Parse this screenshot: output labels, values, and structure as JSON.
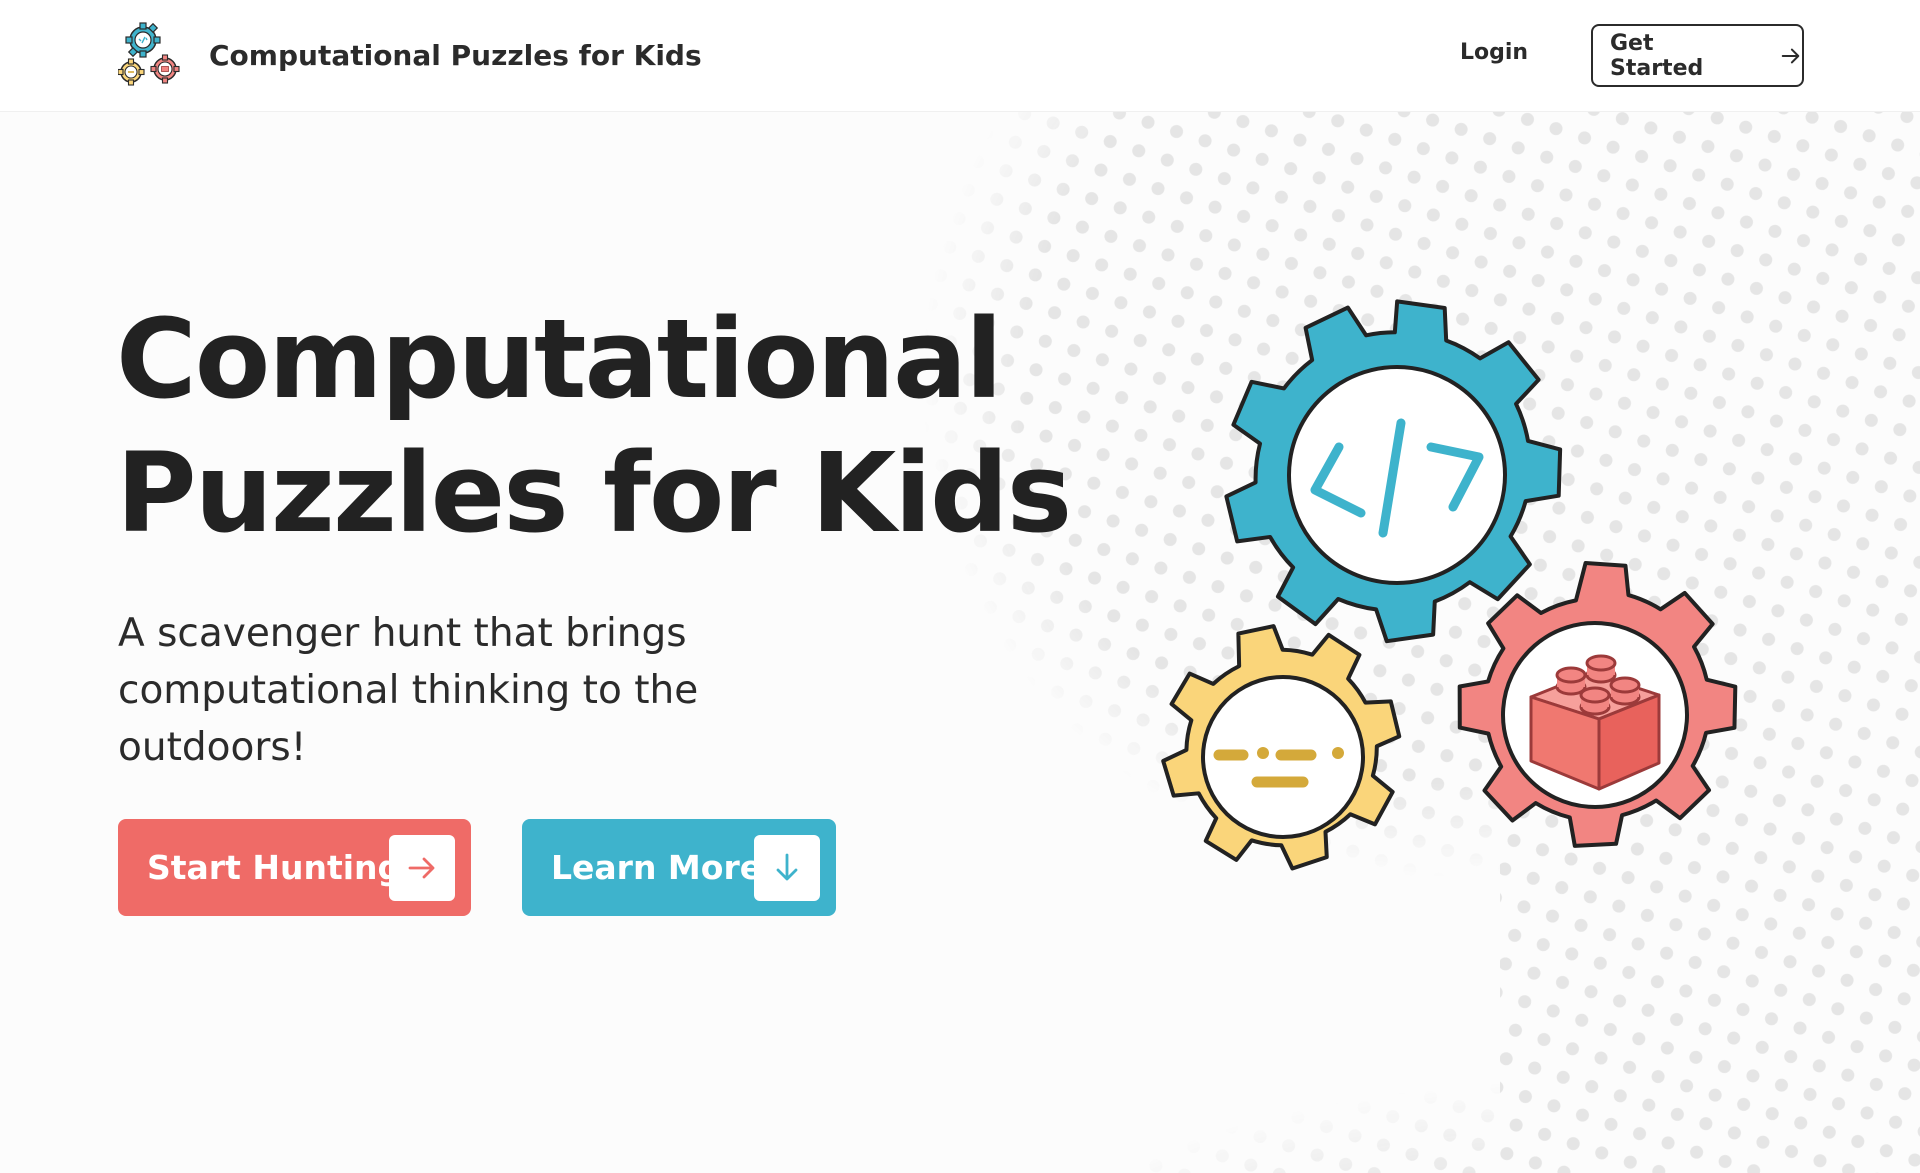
{
  "header": {
    "brand_name": "Computational Puzzles for Kids",
    "login_label": "Login",
    "cta_label": "Get Started",
    "logo_icon": "gears-logo-icon",
    "cta_icon": "arrow-right-icon"
  },
  "hero": {
    "title_line1": "Computational",
    "title_line2": "Puzzles for Kids",
    "subtitle_line1": "A scavenger hunt that brings",
    "subtitle_line2": "computational thinking to the",
    "subtitle_line3": "outdoors!",
    "primary_button": {
      "label": "Start Hunting",
      "icon": "arrow-right-icon",
      "color": "#ef6b67"
    },
    "secondary_button": {
      "label": "Learn More",
      "icon": "arrow-down-icon",
      "color": "#3eb3cc"
    }
  },
  "illustration": {
    "gears": [
      {
        "name": "code-gear",
        "icon": "code-brackets-icon",
        "color": "#3eb3cc"
      },
      {
        "name": "pattern-gear",
        "icon": "dash-pattern-icon",
        "color": "#fad57a"
      },
      {
        "name": "brick-gear",
        "icon": "toy-brick-icon",
        "color": "#f28582"
      }
    ]
  },
  "colors": {
    "text_primary": "#222222",
    "accent_red": "#ef6b67",
    "accent_blue": "#3eb3cc",
    "accent_yellow": "#fad57a",
    "dots": "#e6e6e6"
  }
}
